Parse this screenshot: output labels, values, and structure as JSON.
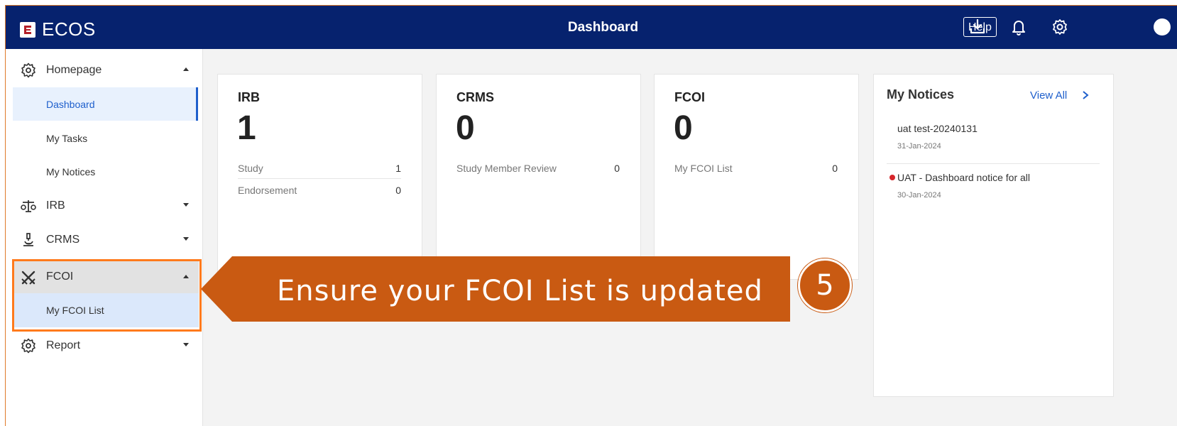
{
  "app": {
    "name": "ECOS",
    "page_title": "Dashboard"
  },
  "header": {
    "help_label": "Help",
    "icons": [
      "download-icon",
      "bell-icon",
      "gear-icon",
      "avatar"
    ]
  },
  "sidebar": {
    "groups": [
      {
        "label": "Homepage",
        "icon": "gear-icon",
        "expanded": true
      },
      {
        "label": "IRB",
        "icon": "scales-icon",
        "expanded": false
      },
      {
        "label": "CRMS",
        "icon": "microscope-icon",
        "expanded": false
      },
      {
        "label": "FCOI",
        "icon": "crossed-swords-icon",
        "expanded": true
      },
      {
        "label": "Report",
        "icon": "gear-icon",
        "expanded": false
      }
    ],
    "homepage_items": [
      "Dashboard",
      "My Tasks",
      "My Notices"
    ],
    "fcoi_items": [
      "My FCOI List"
    ],
    "active_item": "Dashboard"
  },
  "cards": [
    {
      "title": "IRB",
      "count": "1",
      "rows": [
        {
          "label": "Study",
          "value": "1"
        },
        {
          "label": "Endorsement",
          "value": "0"
        }
      ]
    },
    {
      "title": "CRMS",
      "count": "0",
      "rows": [
        {
          "label": "Study Member Review",
          "value": "0"
        }
      ]
    },
    {
      "title": "FCOI",
      "count": "0",
      "rows": [
        {
          "label": "My FCOI List",
          "value": "0"
        }
      ]
    }
  ],
  "notices": {
    "title": "My Notices",
    "view_all": "View All",
    "items": [
      {
        "title": "uat test-20240131",
        "date": "31-Jan-2024",
        "unread": false
      },
      {
        "title": "UAT - Dashboard notice for all",
        "date": "30-Jan-2024",
        "unread": true
      }
    ]
  },
  "callout": {
    "text": "Ensure your FCOI List is updated",
    "step": "5"
  },
  "colors": {
    "header": "#06226e",
    "accent": "#1e5fcc",
    "callout": "#c95a12",
    "highlight": "#ff7a1c",
    "unread": "#d7262b"
  }
}
